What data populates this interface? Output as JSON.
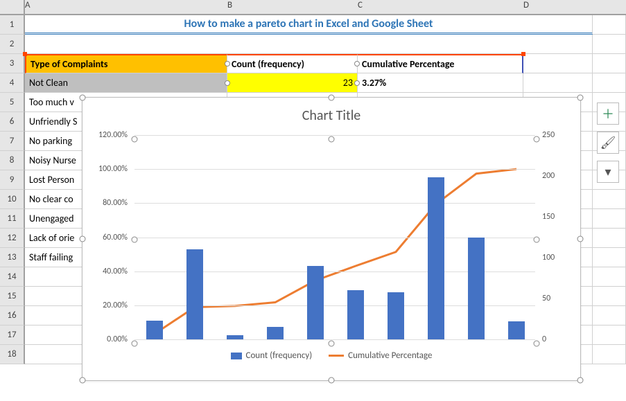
{
  "columns": [
    "A",
    "B",
    "C",
    "D"
  ],
  "rows": [
    "1",
    "2",
    "3",
    "4",
    "5",
    "6",
    "7",
    "8",
    "9",
    "10",
    "11",
    "12",
    "13",
    "14",
    "15",
    "16",
    "17",
    "18"
  ],
  "title": "How to make a pareto chart in Excel and Google Sheet",
  "headers": {
    "a": "Type of Complaints",
    "b": "Count (frequency)",
    "c": "Cumulative Percentage"
  },
  "row4": {
    "a": "Not Clean",
    "b": "23",
    "c": "3.27%"
  },
  "col_a": [
    "Too much v",
    "Unfriendly S",
    "No parking",
    "Noisy Nurse",
    "Lost Person",
    "No clear co",
    "Unengaged",
    "Lack of orie",
    "Staff failing"
  ],
  "chart": {
    "title": "Chart Title",
    "legend_bar": "Count (frequency)",
    "legend_line": "Cumulative Percentage",
    "ylabels_left": [
      "0.00%",
      "20.00%",
      "40.00%",
      "60.00%",
      "80.00%",
      "100.00%",
      "120.00%"
    ],
    "ylabels_right": [
      "0",
      "50",
      "100",
      "150",
      "200",
      "250"
    ]
  },
  "chart_data": {
    "type": "bar+line (pareto combo)",
    "categories": [
      "Not Clean",
      "Too much v",
      "Unfriendly S",
      "No parking",
      "Noisy Nurse",
      "Lost Person",
      "No clear co",
      "Unengaged",
      "Lack of orie",
      "Staff failing"
    ],
    "series": [
      {
        "name": "Count (frequency)",
        "type": "bar",
        "axis": "secondary",
        "values": [
          23,
          110,
          5,
          15,
          90,
          60,
          58,
          198,
          125,
          22
        ]
      },
      {
        "name": "Cumulative Percentage",
        "type": "line",
        "axis": "primary",
        "values": [
          3.27,
          18.92,
          19.63,
          21.76,
          34.57,
          43.11,
          51.36,
          79.53,
          97.32,
          100.0
        ]
      }
    ],
    "title": "Chart Title",
    "primary_axis": {
      "label": "",
      "range": [
        0,
        120
      ],
      "unit": "%"
    },
    "secondary_axis": {
      "label": "",
      "range": [
        0,
        250
      ]
    },
    "grid": true
  }
}
